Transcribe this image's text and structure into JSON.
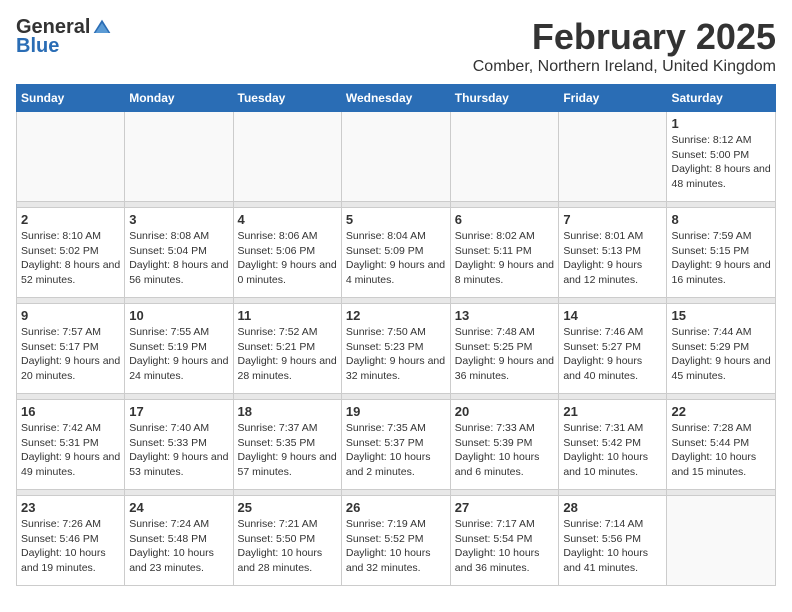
{
  "logo": {
    "general": "General",
    "blue": "Blue"
  },
  "header": {
    "month": "February 2025",
    "location": "Comber, Northern Ireland, United Kingdom"
  },
  "days_of_week": [
    "Sunday",
    "Monday",
    "Tuesday",
    "Wednesday",
    "Thursday",
    "Friday",
    "Saturday"
  ],
  "weeks": [
    [
      {
        "day": "",
        "info": ""
      },
      {
        "day": "",
        "info": ""
      },
      {
        "day": "",
        "info": ""
      },
      {
        "day": "",
        "info": ""
      },
      {
        "day": "",
        "info": ""
      },
      {
        "day": "",
        "info": ""
      },
      {
        "day": "1",
        "info": "Sunrise: 8:12 AM\nSunset: 5:00 PM\nDaylight: 8 hours and 48 minutes."
      }
    ],
    [
      {
        "day": "2",
        "info": "Sunrise: 8:10 AM\nSunset: 5:02 PM\nDaylight: 8 hours and 52 minutes."
      },
      {
        "day": "3",
        "info": "Sunrise: 8:08 AM\nSunset: 5:04 PM\nDaylight: 8 hours and 56 minutes."
      },
      {
        "day": "4",
        "info": "Sunrise: 8:06 AM\nSunset: 5:06 PM\nDaylight: 9 hours and 0 minutes."
      },
      {
        "day": "5",
        "info": "Sunrise: 8:04 AM\nSunset: 5:09 PM\nDaylight: 9 hours and 4 minutes."
      },
      {
        "day": "6",
        "info": "Sunrise: 8:02 AM\nSunset: 5:11 PM\nDaylight: 9 hours and 8 minutes."
      },
      {
        "day": "7",
        "info": "Sunrise: 8:01 AM\nSunset: 5:13 PM\nDaylight: 9 hours and 12 minutes."
      },
      {
        "day": "8",
        "info": "Sunrise: 7:59 AM\nSunset: 5:15 PM\nDaylight: 9 hours and 16 minutes."
      }
    ],
    [
      {
        "day": "9",
        "info": "Sunrise: 7:57 AM\nSunset: 5:17 PM\nDaylight: 9 hours and 20 minutes."
      },
      {
        "day": "10",
        "info": "Sunrise: 7:55 AM\nSunset: 5:19 PM\nDaylight: 9 hours and 24 minutes."
      },
      {
        "day": "11",
        "info": "Sunrise: 7:52 AM\nSunset: 5:21 PM\nDaylight: 9 hours and 28 minutes."
      },
      {
        "day": "12",
        "info": "Sunrise: 7:50 AM\nSunset: 5:23 PM\nDaylight: 9 hours and 32 minutes."
      },
      {
        "day": "13",
        "info": "Sunrise: 7:48 AM\nSunset: 5:25 PM\nDaylight: 9 hours and 36 minutes."
      },
      {
        "day": "14",
        "info": "Sunrise: 7:46 AM\nSunset: 5:27 PM\nDaylight: 9 hours and 40 minutes."
      },
      {
        "day": "15",
        "info": "Sunrise: 7:44 AM\nSunset: 5:29 PM\nDaylight: 9 hours and 45 minutes."
      }
    ],
    [
      {
        "day": "16",
        "info": "Sunrise: 7:42 AM\nSunset: 5:31 PM\nDaylight: 9 hours and 49 minutes."
      },
      {
        "day": "17",
        "info": "Sunrise: 7:40 AM\nSunset: 5:33 PM\nDaylight: 9 hours and 53 minutes."
      },
      {
        "day": "18",
        "info": "Sunrise: 7:37 AM\nSunset: 5:35 PM\nDaylight: 9 hours and 57 minutes."
      },
      {
        "day": "19",
        "info": "Sunrise: 7:35 AM\nSunset: 5:37 PM\nDaylight: 10 hours and 2 minutes."
      },
      {
        "day": "20",
        "info": "Sunrise: 7:33 AM\nSunset: 5:39 PM\nDaylight: 10 hours and 6 minutes."
      },
      {
        "day": "21",
        "info": "Sunrise: 7:31 AM\nSunset: 5:42 PM\nDaylight: 10 hours and 10 minutes."
      },
      {
        "day": "22",
        "info": "Sunrise: 7:28 AM\nSunset: 5:44 PM\nDaylight: 10 hours and 15 minutes."
      }
    ],
    [
      {
        "day": "23",
        "info": "Sunrise: 7:26 AM\nSunset: 5:46 PM\nDaylight: 10 hours and 19 minutes."
      },
      {
        "day": "24",
        "info": "Sunrise: 7:24 AM\nSunset: 5:48 PM\nDaylight: 10 hours and 23 minutes."
      },
      {
        "day": "25",
        "info": "Sunrise: 7:21 AM\nSunset: 5:50 PM\nDaylight: 10 hours and 28 minutes."
      },
      {
        "day": "26",
        "info": "Sunrise: 7:19 AM\nSunset: 5:52 PM\nDaylight: 10 hours and 32 minutes."
      },
      {
        "day": "27",
        "info": "Sunrise: 7:17 AM\nSunset: 5:54 PM\nDaylight: 10 hours and 36 minutes."
      },
      {
        "day": "28",
        "info": "Sunrise: 7:14 AM\nSunset: 5:56 PM\nDaylight: 10 hours and 41 minutes."
      },
      {
        "day": "",
        "info": ""
      }
    ]
  ]
}
